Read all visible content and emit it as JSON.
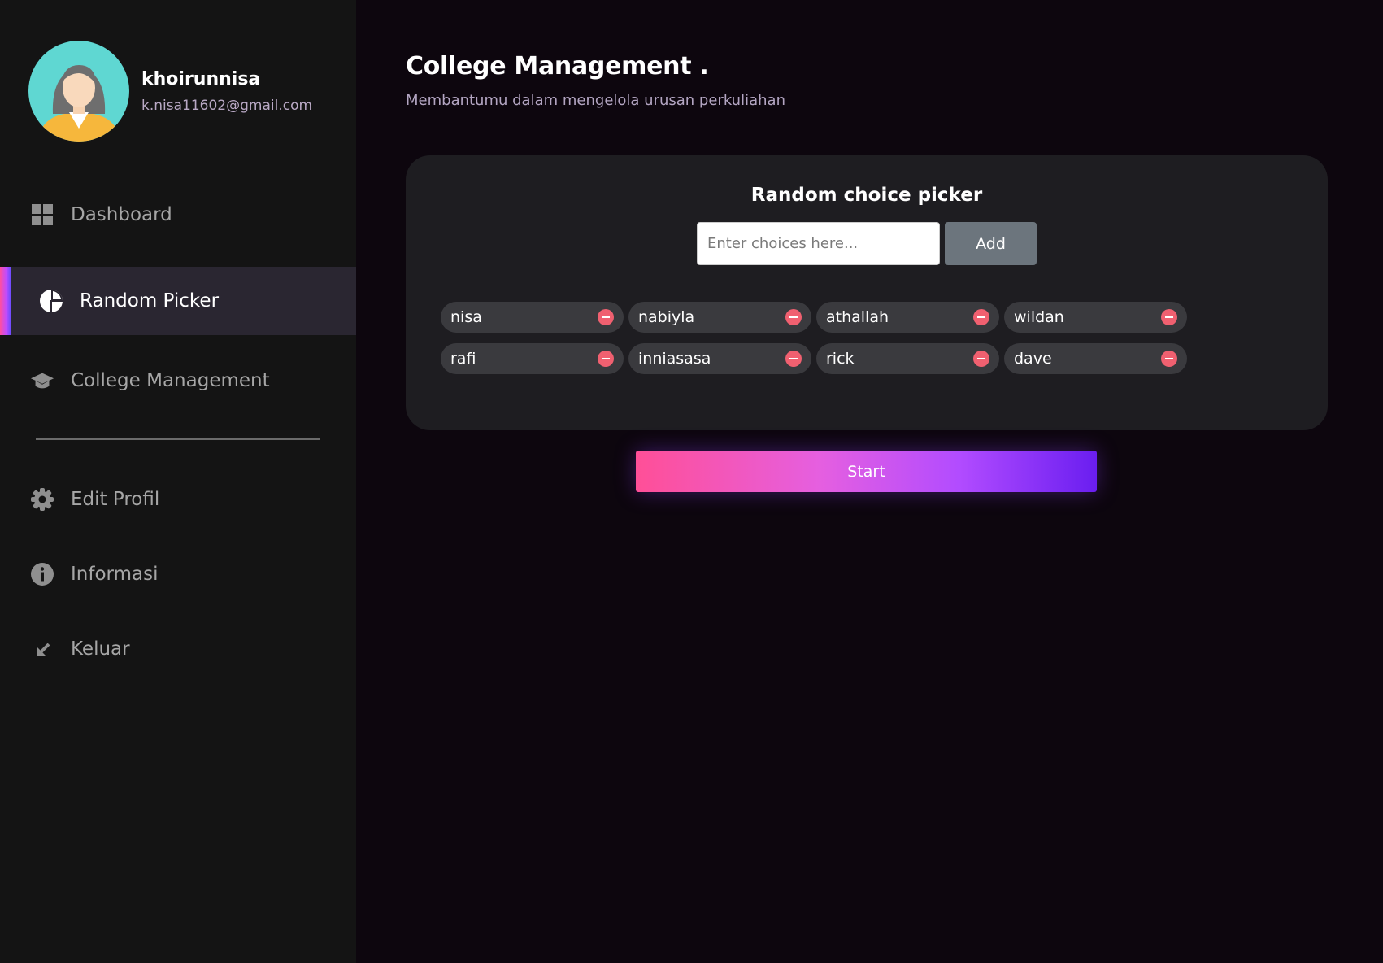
{
  "profile": {
    "name": "khoirunnisa",
    "email": "k.nisa11602@gmail.com"
  },
  "sidebar": {
    "items": [
      {
        "label": "Dashboard",
        "icon": "grid-icon",
        "active": false
      },
      {
        "label": "Random Picker",
        "icon": "pie-chart-icon",
        "active": true
      },
      {
        "label": "College Management",
        "icon": "graduation-cap-icon",
        "active": false
      },
      {
        "label": "Edit Profil",
        "icon": "gear-icon",
        "active": false
      },
      {
        "label": "Informasi",
        "icon": "info-icon",
        "active": false
      },
      {
        "label": "Keluar",
        "icon": "arrow-down-left-icon",
        "active": false
      }
    ]
  },
  "header": {
    "title": "College Management .",
    "subtitle": "Membantumu dalam mengelola urusan perkuliahan"
  },
  "picker": {
    "title": "Random choice picker",
    "input_placeholder": "Enter choices here...",
    "input_value": "",
    "add_label": "Add",
    "choices": [
      "nisa",
      "nabiyla",
      "athallah",
      "wildan",
      "rafi",
      "inniasasa",
      "rick",
      "dave"
    ],
    "start_label": "Start"
  },
  "colors": {
    "accent_gradient": [
      "#ff4f97",
      "#b24cff",
      "#6a1ef0"
    ],
    "remove_badge": "#f06070"
  }
}
